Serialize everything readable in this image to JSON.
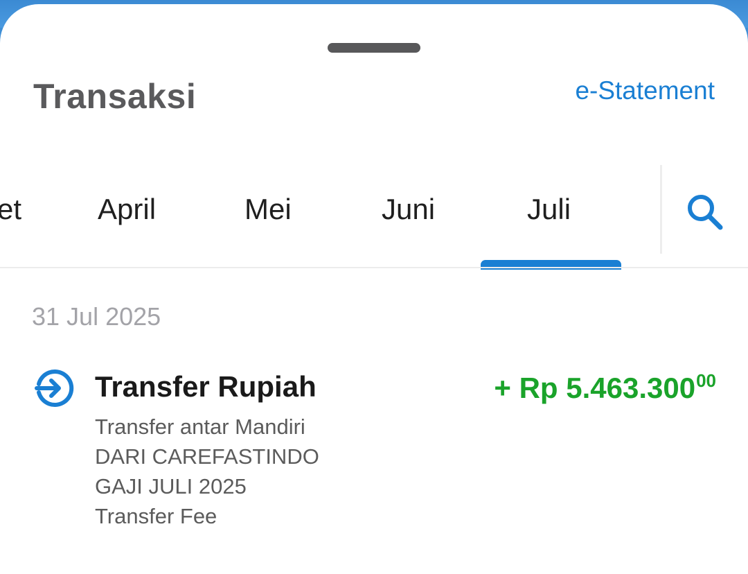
{
  "header": {
    "title": "Transaksi",
    "estatement_label": "e-Statement"
  },
  "month_tabs": {
    "items": [
      {
        "label": "Maret",
        "visible_fragment": "et"
      },
      {
        "label": "April"
      },
      {
        "label": "Mei"
      },
      {
        "label": "Juni"
      },
      {
        "label": "Juli",
        "selected": true
      }
    ],
    "search_icon": "search-icon"
  },
  "transactions": {
    "date": "31 Jul 2025",
    "items": [
      {
        "icon": "transfer-in-icon",
        "title": "Transfer Rupiah",
        "amount_main": "+ Rp 5.463.300",
        "amount_cents": "00",
        "description": [
          "Transfer antar Mandiri",
          "DARI CAREFASTINDO",
          "GAJI JULI 2025",
          "Transfer Fee"
        ]
      }
    ]
  },
  "colors": {
    "accent": "#1a7fd3",
    "amount_positive": "#1aa32a",
    "title_text": "#5a5a5c",
    "muted_text": "#a3a3a8",
    "top_background": "#3f8fd6"
  }
}
